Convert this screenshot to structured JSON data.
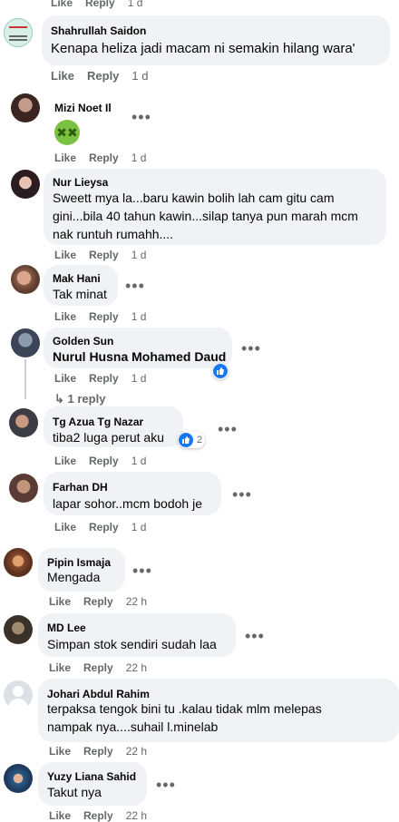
{
  "top_actions": {
    "like": "Like",
    "reply": "Reply",
    "time": "1 d"
  },
  "comments": [
    {
      "author": "Shahrullah Saidon",
      "text": "Kenapa heliza jadi macam ni semakin hilang wara'",
      "like": "Like",
      "reply": "Reply",
      "time": "1 d"
    },
    {
      "author": "Mizi Noet Il",
      "text": "",
      "emoji": "nauseated-face",
      "like": "Like",
      "reply": "Reply",
      "time": "1 d"
    },
    {
      "author": "Nur Lieysa",
      "lines": [
        "Sweett mya la...baru kawin bolih lah cam gitu cam",
        "gini...bila 40 tahun kawin...silap tanya pun marah mcm",
        "nak runtuh rumahh...."
      ],
      "like": "Like",
      "reply": "Reply",
      "time": "1 d"
    },
    {
      "author": "Mak Hani",
      "text": "Tak minat",
      "like": "Like",
      "reply": "Reply",
      "time": "1 d"
    },
    {
      "author": "Golden Sun",
      "text": "Nurul Husna Mohamed Daud",
      "like": "Like",
      "reply": "Reply",
      "time": "1 d",
      "replies": "1 reply"
    },
    {
      "author": "Tg Azua Tg Nazar",
      "text": "tiba2 luga perut aku",
      "like": "Like",
      "reply": "Reply",
      "time": "1 d",
      "reaction_count": "2"
    },
    {
      "author": "Farhan DH",
      "text": "lapar sohor..mcm bodoh je",
      "like": "Like",
      "reply": "Reply",
      "time": "1 d"
    },
    {
      "author": "Pipin Ismaja",
      "text": "Mengada",
      "like": "Like",
      "reply": "Reply",
      "time": "22 h"
    },
    {
      "author": "MD Lee",
      "text": "Simpan stok sendiri sudah laa",
      "like": "Like",
      "reply": "Reply",
      "time": "22 h"
    },
    {
      "author": "Johari Abdul Rahim",
      "lines": [
        "terpaksa tengok bini tu .kalau tidak mlm melepas",
        "nampak nya....suhail l.minelab"
      ],
      "like": "Like",
      "reply": "Reply",
      "time": "22 h"
    },
    {
      "author": "Yuzy Liana Sahid",
      "text": "Takut nya",
      "like": "Like",
      "reply": "Reply",
      "time": "22 h"
    }
  ],
  "colors": {
    "bubble": "#f0f2f5",
    "secondary": "#65676b",
    "like_blue": "#1877f2"
  }
}
